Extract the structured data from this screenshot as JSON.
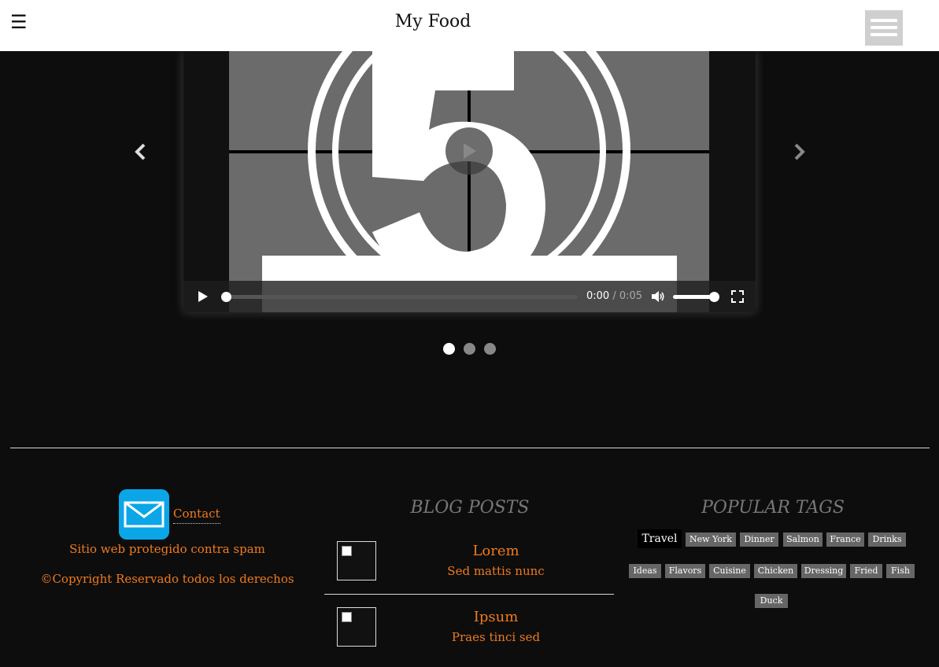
{
  "header": {
    "menu_glyph": "☰",
    "title": "My Food"
  },
  "video": {
    "current_time": "0:00",
    "separator": "/",
    "duration": "0:05",
    "progress": 0,
    "volume": 1
  },
  "slider": {
    "slide_count": 3,
    "active_slide": 0
  },
  "footer": {
    "contact_label": "Contact",
    "spam_note": "Sitio web protegido contra spam",
    "copyright": "©Copyright Reservado todos los derechos",
    "blog_heading": "BLOG POSTS",
    "posts": [
      {
        "title": "Lorem",
        "subtitle": "Sed mattis nunc"
      },
      {
        "title": "Ipsum",
        "subtitle": "Praes tinci sed"
      }
    ],
    "tags_heading": "POPULAR TAGS",
    "tags": [
      "Travel",
      "New York",
      "Dinner",
      "Salmon",
      "France",
      "Drinks",
      "Ideas",
      "Flavors",
      "Cuisine",
      "Chicken",
      "Dressing",
      "Fried",
      "Fish",
      "Duck"
    ]
  },
  "colors": {
    "accent": "#f07a1e",
    "background": "#0d0d0d",
    "mail_icon": "#0aa6e8"
  },
  "icons": [
    "menu-icon",
    "play-icon",
    "volume-icon",
    "fullscreen-icon",
    "chevron-left-icon",
    "chevron-right-icon",
    "mail-icon",
    "broken-image-icon"
  ]
}
